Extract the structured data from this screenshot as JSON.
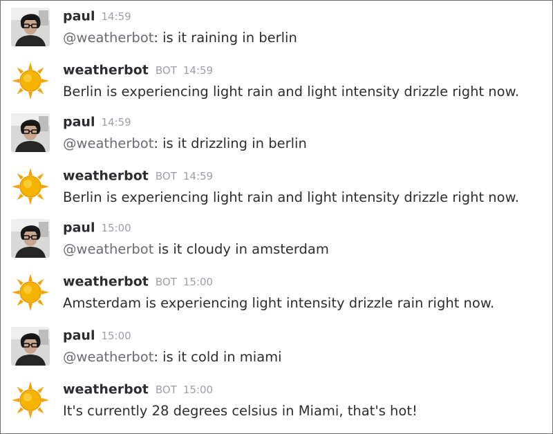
{
  "users": {
    "paul": {
      "name": "paul",
      "avatar_icon": "user-photo-avatar"
    },
    "weatherbot": {
      "name": "weatherbot",
      "badge": "BOT",
      "avatar_icon": "sun-icon",
      "sun_color": "#f6b400",
      "ray_color": "#f0a30a"
    }
  },
  "messages": [
    {
      "user": "paul",
      "time": "14:59",
      "mention": "@weatherbot",
      "text": ": is it raining in berlin"
    },
    {
      "user": "weatherbot",
      "badge": "BOT",
      "time": "14:59",
      "text": "Berlin is experiencing light rain and light intensity drizzle right now."
    },
    {
      "user": "paul",
      "time": "14:59",
      "mention": "@weatherbot",
      "text": ": is it drizzling in berlin"
    },
    {
      "user": "weatherbot",
      "badge": "BOT",
      "time": "14:59",
      "text": "Berlin is experiencing light rain and light intensity drizzle right now."
    },
    {
      "user": "paul",
      "time": "15:00",
      "mention": "@weatherbot",
      "text": " is it cloudy in amsterdam"
    },
    {
      "user": "weatherbot",
      "badge": "BOT",
      "time": "15:00",
      "text": "Amsterdam is experiencing light intensity drizzle rain right now."
    },
    {
      "user": "paul",
      "time": "15:00",
      "mention": "@weatherbot",
      "text": ": is it cold in miami"
    },
    {
      "user": "weatherbot",
      "badge": "BOT",
      "time": "15:00",
      "text": "It's currently 28 degrees celsius in Miami, that's hot!"
    }
  ]
}
